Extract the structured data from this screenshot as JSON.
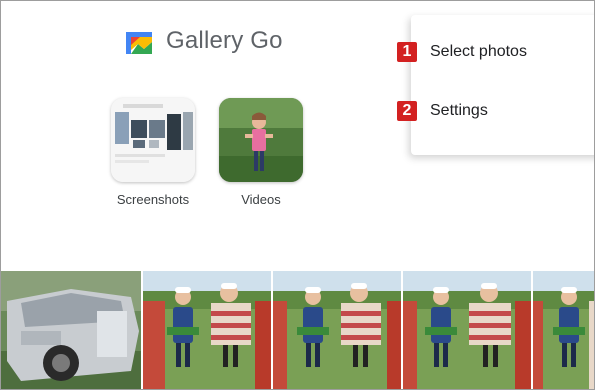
{
  "app": {
    "title": "Gallery Go",
    "logo_icon": "gallery-go-logo"
  },
  "albums": [
    {
      "label": "Screenshots",
      "icon": "screenshots-thumbnail"
    },
    {
      "label": "Videos",
      "icon": "videos-thumbnail"
    }
  ],
  "menu": {
    "items": [
      {
        "badge": "1",
        "label": "Select photos"
      },
      {
        "badge": "2",
        "label": "Settings"
      }
    ]
  },
  "photo_strip": {
    "photos": [
      "car-photo",
      "kids-photo-1",
      "kids-photo-2",
      "kids-photo-3",
      "kids-photo-4"
    ]
  },
  "colors": {
    "badge_red": "#d32121",
    "title_gray": "#5f6368",
    "sky": "#cfe0ec",
    "grass": "#5a8a3a"
  }
}
